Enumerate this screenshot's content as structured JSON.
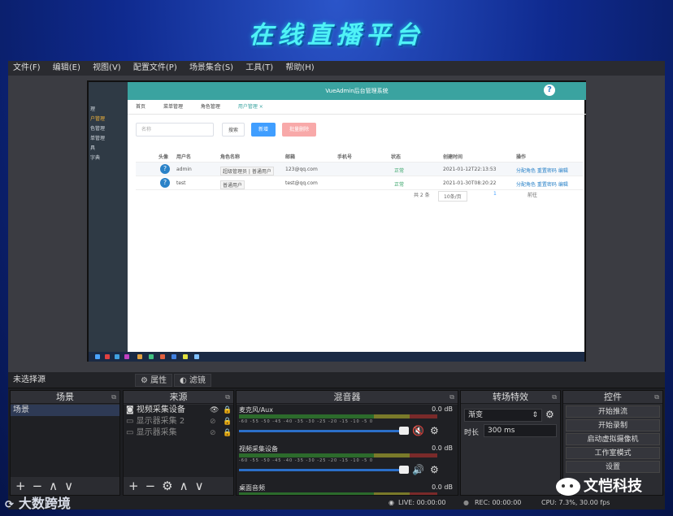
{
  "slide": {
    "title": "在线直播平台"
  },
  "obs": {
    "menu": [
      "文件(F)",
      "编辑(E)",
      "视图(V)",
      "配置文件(P)",
      "场景集合(S)",
      "工具(T)",
      "帮助(H)"
    ],
    "preview": {
      "app_title": "VueAdmin后台管理系统",
      "help_icon": "?",
      "sidebar": [
        "理",
        "户管理",
        "色管理",
        "单管理",
        "具",
        "字典"
      ],
      "tabs": [
        "首页",
        "菜单管理",
        "角色管理",
        "用户管理 ×"
      ],
      "filter": {
        "placeholder": "名称",
        "search": "搜索",
        "add": "新增",
        "batch_delete": "批量删除"
      },
      "table": {
        "headers": [
          "头像",
          "用户名",
          "角色名称",
          "邮箱",
          "手机号",
          "状态",
          "创建时间",
          "操作"
        ],
        "rows": [
          {
            "username": "admin",
            "roles": "超级管理员 | 普通用户",
            "email": "123@qq.com",
            "status": "正常",
            "created": "2021-01-12T22:13:53",
            "ops": "分配角色  重置密码  编辑"
          },
          {
            "username": "test",
            "roles": "普通用户",
            "email": "test@qq.com",
            "status": "正常",
            "created": "2021-01-30T08:20:22",
            "ops": "分配角色  重置密码  编辑"
          }
        ]
      },
      "pager": {
        "total": "共 2 条",
        "size": "10条/页",
        "page": "1",
        "goto": "前往"
      }
    },
    "source_bar": {
      "label": "未选择源",
      "properties": "属性",
      "filters": "滤镜"
    },
    "docks": {
      "scenes": {
        "title": "场景",
        "items": [
          "场景"
        ]
      },
      "sources": {
        "title": "来源",
        "items": [
          "视频采集设备",
          "显示器采集 2",
          "显示器采集"
        ]
      },
      "mixer": {
        "title": "混音器",
        "channels": [
          {
            "name": "麦克风/Aux",
            "db": "0.0 dB"
          },
          {
            "name": "视频采集设备",
            "db": "0.0 dB"
          },
          {
            "name": "桌面音频",
            "db": "0.0 dB"
          }
        ],
        "ticks": "-60 -55 -50 -45 -40 -35 -30 -25 -20 -15 -10 -5 0"
      },
      "transitions": {
        "title": "转场特效",
        "type": "渐变",
        "duration_label": "时长",
        "duration": "300 ms"
      },
      "controls": {
        "title": "控件",
        "buttons": [
          "开始推流",
          "开始录制",
          "启动虚拟摄像机",
          "工作室模式",
          "设置"
        ]
      }
    },
    "status": {
      "live": "LIVE: 00:00:00",
      "rec": "REC: 00:00:00",
      "cpu": "CPU: 7.3%, 30.00 fps"
    }
  },
  "watermarks": {
    "left": "大数跨境",
    "right": "文恺科技"
  },
  "colors": {
    "title_cyan": "#4ff2f6",
    "obs_bg": "#1d1e22",
    "teal_bar": "#3aa3a0",
    "mute_red": "#e02020"
  }
}
